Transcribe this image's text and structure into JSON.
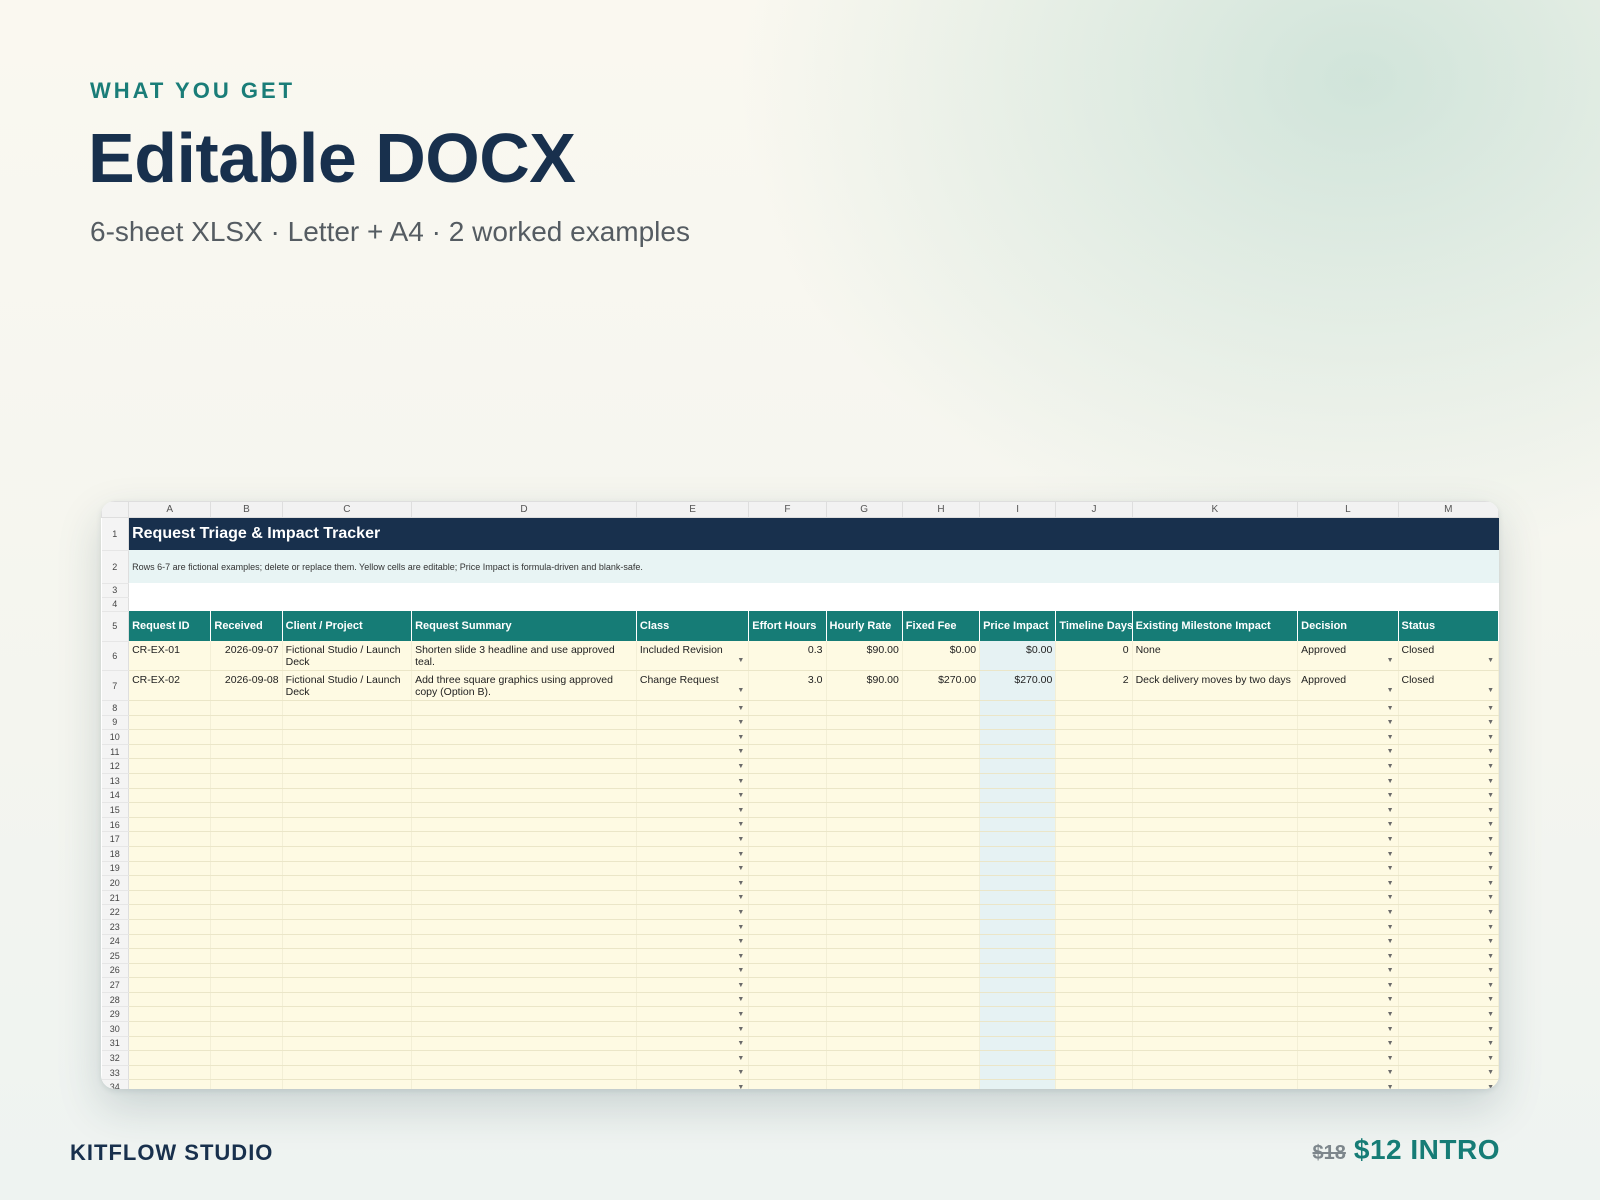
{
  "hero": {
    "eyebrow": "WHAT YOU GET",
    "title": "Editable DOCX",
    "subtitle": "6-sheet XLSX · Letter + A4 · 2 worked examples"
  },
  "footer": {
    "brand": "KITFLOW STUDIO",
    "old_price": "$18",
    "new_price": "$12 INTRO"
  },
  "colors": {
    "accent": "#1a7d78",
    "navy": "#18304d",
    "header_teal": "#167c76",
    "editable_cell": "#fefae3",
    "formula_cell": "#e6f2f3"
  },
  "sheet": {
    "columns": [
      "A",
      "B",
      "C",
      "D",
      "E",
      "F",
      "G",
      "H",
      "I",
      "J",
      "K",
      "L",
      "M"
    ],
    "title": "Request Triage & Impact Tracker",
    "note": "Rows 6-7 are fictional examples; delete or replace them. Yellow cells are editable; Price Impact is formula-driven and blank-safe.",
    "headers": [
      "Request ID",
      "Received",
      "Client / Project",
      "Request Summary",
      "Class",
      "Effort Hours",
      "Hourly Rate",
      "Fixed Fee",
      "Price Impact",
      "Timeline Days",
      "Existing Milestone Impact",
      "Decision",
      "Status"
    ],
    "rows": [
      [
        "CR-EX-01",
        "2026-09-07",
        "Fictional Studio / Launch Deck",
        "Shorten slide 3 headline and use approved teal.",
        "Included Revision",
        "0.3",
        "$90.00",
        "$0.00",
        "$0.00",
        "0",
        "None",
        "Approved",
        "Closed"
      ],
      [
        "CR-EX-02",
        "2026-09-08",
        "Fictional Studio / Launch Deck",
        "Add three square graphics using approved copy (Option B).",
        "Change Request",
        "3.0",
        "$90.00",
        "$270.00",
        "$270.00",
        "2",
        "Deck delivery moves by two days",
        "Approved",
        "Closed"
      ]
    ],
    "row_numbers": [
      "1",
      "2",
      "3",
      "4",
      "5",
      "6",
      "7",
      "8",
      "9",
      "10",
      "11",
      "12",
      "13",
      "14",
      "15",
      "16",
      "17",
      "18",
      "19",
      "20",
      "21",
      "22",
      "23",
      "24",
      "25",
      "26",
      "27",
      "28",
      "29",
      "30",
      "31",
      "32",
      "33",
      "34"
    ],
    "dropdown_glyph": "▼"
  }
}
